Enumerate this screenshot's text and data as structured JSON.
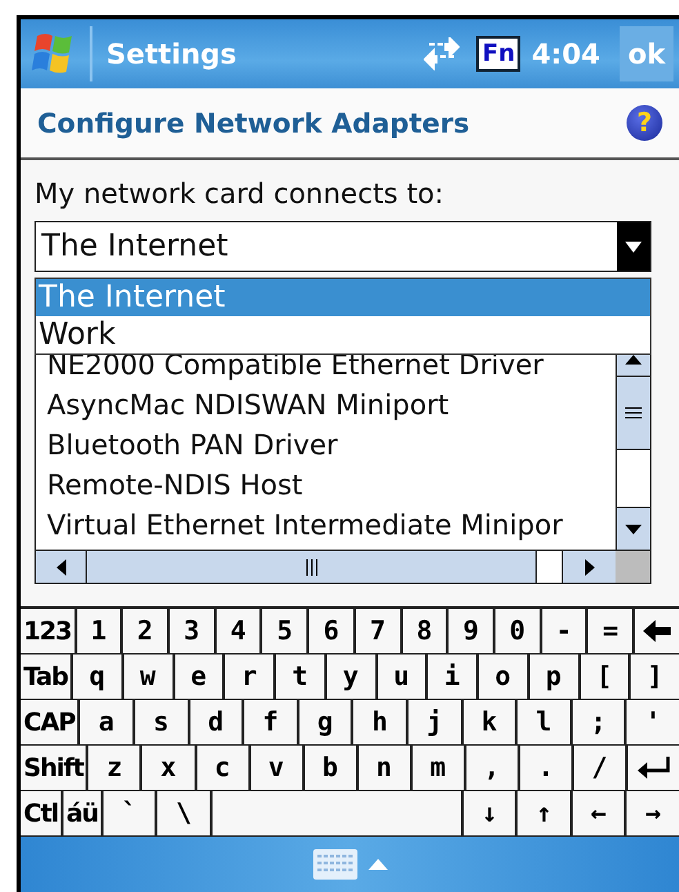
{
  "title_bar": {
    "app_title": "Settings",
    "fn_label": "Fn",
    "clock": "4:04",
    "ok_label": "ok"
  },
  "header": {
    "title": "Configure Network Adapters",
    "help_label": "?"
  },
  "connects_label": "My network card connects to:",
  "dropdown": {
    "value": "The Internet",
    "expanded": true,
    "options": [
      {
        "label": "The Internet",
        "selected": true
      },
      {
        "label": "Work",
        "selected": false
      }
    ]
  },
  "adapters": [
    {
      "name": "NE2000 Compatible Ethernet Driver"
    },
    {
      "name": "AsyncMac NDISWAN Miniport"
    },
    {
      "name": "Bluetooth PAN Driver"
    },
    {
      "name": "Remote-NDIS Host"
    },
    {
      "name": "Virtual Ethernet Intermediate Minipor"
    }
  ],
  "keyboard": {
    "rows": [
      {
        "keys": [
          {
            "kind": "mod",
            "label": "123"
          },
          {
            "kind": "key",
            "label": "1"
          },
          {
            "kind": "key",
            "label": "2"
          },
          {
            "kind": "key",
            "label": "3"
          },
          {
            "kind": "key",
            "label": "4"
          },
          {
            "kind": "key",
            "label": "5"
          },
          {
            "kind": "key",
            "label": "6"
          },
          {
            "kind": "key",
            "label": "7"
          },
          {
            "kind": "key",
            "label": "8"
          },
          {
            "kind": "key",
            "label": "9"
          },
          {
            "kind": "key",
            "label": "0"
          },
          {
            "kind": "key",
            "label": "-"
          },
          {
            "kind": "key",
            "label": "="
          },
          {
            "kind": "backspace"
          }
        ]
      },
      {
        "keys": [
          {
            "kind": "mod",
            "label": "Tab"
          },
          {
            "kind": "key",
            "label": "q"
          },
          {
            "kind": "key",
            "label": "w"
          },
          {
            "kind": "key",
            "label": "e"
          },
          {
            "kind": "key",
            "label": "r"
          },
          {
            "kind": "key",
            "label": "t"
          },
          {
            "kind": "key",
            "label": "y"
          },
          {
            "kind": "key",
            "label": "u"
          },
          {
            "kind": "key",
            "label": "i"
          },
          {
            "kind": "key",
            "label": "o"
          },
          {
            "kind": "key",
            "label": "p"
          },
          {
            "kind": "key",
            "label": "["
          },
          {
            "kind": "key",
            "label": "]"
          }
        ]
      },
      {
        "keys": [
          {
            "kind": "mod",
            "label": "CAP"
          },
          {
            "kind": "key",
            "label": "a"
          },
          {
            "kind": "key",
            "label": "s"
          },
          {
            "kind": "key",
            "label": "d"
          },
          {
            "kind": "key",
            "label": "f"
          },
          {
            "kind": "key",
            "label": "g"
          },
          {
            "kind": "key",
            "label": "h"
          },
          {
            "kind": "key",
            "label": "j"
          },
          {
            "kind": "key",
            "label": "k"
          },
          {
            "kind": "key",
            "label": "l"
          },
          {
            "kind": "key",
            "label": ";"
          },
          {
            "kind": "key",
            "label": "'"
          }
        ]
      },
      {
        "keys": [
          {
            "kind": "mod",
            "label": "Shift"
          },
          {
            "kind": "key",
            "label": "z"
          },
          {
            "kind": "key",
            "label": "x"
          },
          {
            "kind": "key",
            "label": "c"
          },
          {
            "kind": "key",
            "label": "v"
          },
          {
            "kind": "key",
            "label": "b"
          },
          {
            "kind": "key",
            "label": "n"
          },
          {
            "kind": "key",
            "label": "m"
          },
          {
            "kind": "key",
            "label": ","
          },
          {
            "kind": "key",
            "label": "."
          },
          {
            "kind": "key",
            "label": "/"
          },
          {
            "kind": "enter"
          }
        ]
      },
      {
        "keys": [
          {
            "kind": "mod",
            "label": "Ctl"
          },
          {
            "kind": "mod",
            "label": "áü"
          },
          {
            "kind": "key",
            "label": "`"
          },
          {
            "kind": "key",
            "label": "\\"
          },
          {
            "kind": "space"
          },
          {
            "kind": "key",
            "label": "↓"
          },
          {
            "kind": "key",
            "label": "↑"
          },
          {
            "kind": "key",
            "label": "←"
          },
          {
            "kind": "key",
            "label": "→"
          }
        ]
      }
    ]
  }
}
